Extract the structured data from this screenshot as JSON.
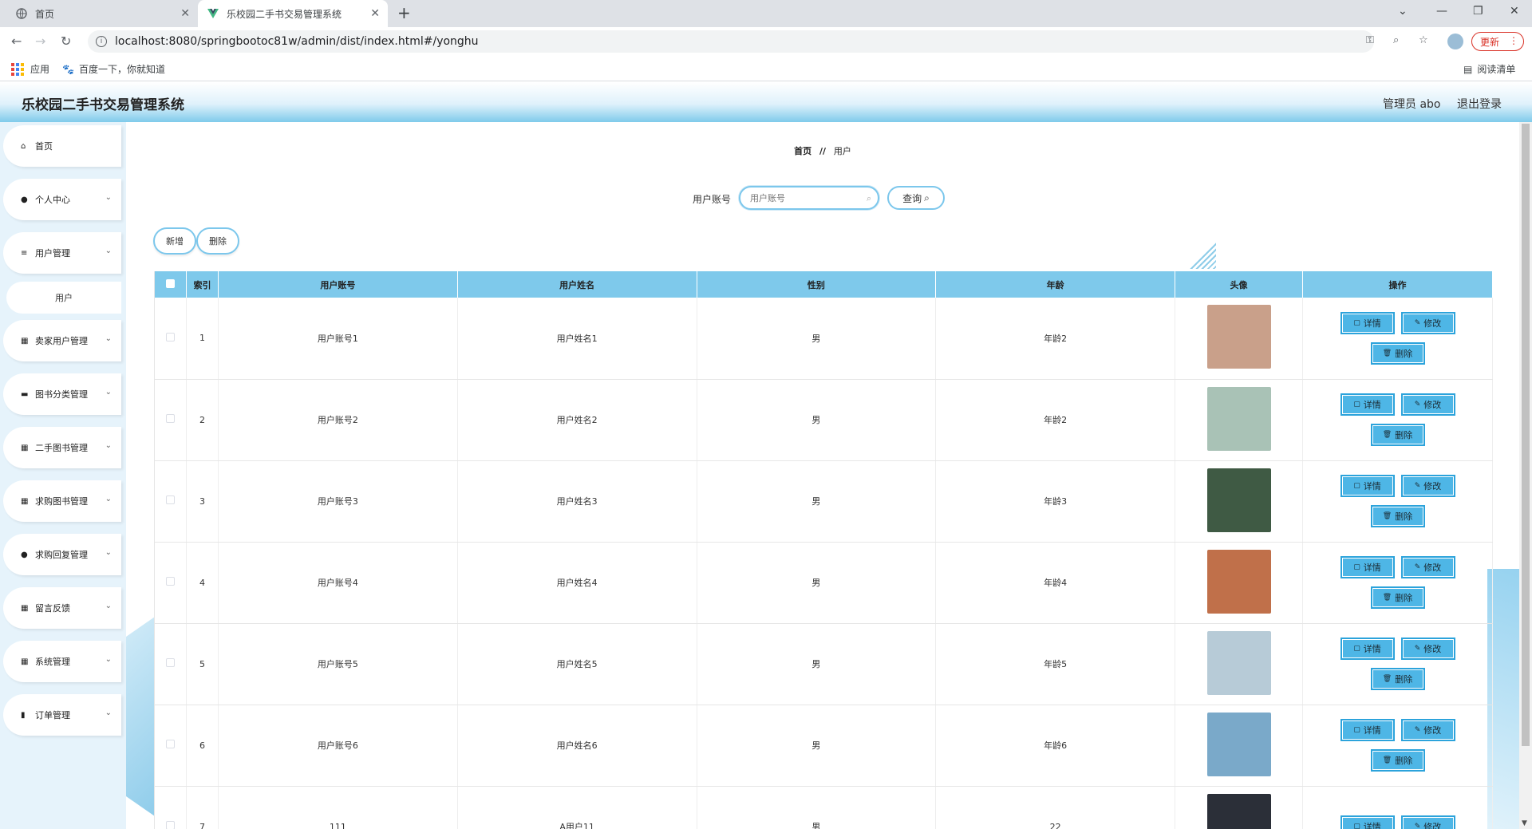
{
  "browser": {
    "tabs": [
      {
        "title": "首页",
        "icon": "globe-icon"
      },
      {
        "title": "乐校园二手书交易管理系统",
        "icon": "vue-icon"
      }
    ],
    "url": "localhost:8080/springbootoc81w/admin/dist/index.html#/yonghu",
    "update_label": "更新",
    "bookmarks": [
      {
        "label": "应用"
      },
      {
        "label": "百度一下，你就知道"
      }
    ],
    "reading_list": "阅读清单"
  },
  "header": {
    "title": "乐校园二手书交易管理系统",
    "user": "管理员 abo",
    "logout": "退出登录"
  },
  "sidebar": {
    "items": [
      {
        "label": "首页",
        "icon": "home-icon"
      },
      {
        "label": "个人中心",
        "icon": "user-icon"
      },
      {
        "label": "用户管理",
        "icon": "sliders-icon"
      },
      {
        "label": "卖家用户管理",
        "icon": "grid-icon"
      },
      {
        "label": "图书分类管理",
        "icon": "briefcase-icon"
      },
      {
        "label": "二手图书管理",
        "icon": "grid-icon"
      },
      {
        "label": "求购图书管理",
        "icon": "grid-icon"
      },
      {
        "label": "求购回复管理",
        "icon": "user-icon"
      },
      {
        "label": "留言反馈",
        "icon": "grid-icon"
      },
      {
        "label": "系统管理",
        "icon": "grid-icon"
      },
      {
        "label": "订单管理",
        "icon": "bar-chart-icon"
      }
    ],
    "sub_active": "用户"
  },
  "main": {
    "breadcrumb": {
      "home": "首页",
      "separator": "//",
      "current": "用户"
    },
    "search": {
      "label": "用户账号",
      "placeholder": "用户账号",
      "button": "查询"
    },
    "add_button": "新增",
    "delete_button": "删除",
    "columns": [
      "索引",
      "用户账号",
      "用户姓名",
      "性别",
      "年龄",
      "头像",
      "操作"
    ],
    "op_labels": {
      "detail": "详情",
      "edit": "修改",
      "delete": "删除"
    },
    "rows": [
      {
        "index": "1",
        "account": "用户账号1",
        "name": "用户姓名1",
        "gender": "男",
        "age": "年龄2",
        "avatar_color": "#c9a08a"
      },
      {
        "index": "2",
        "account": "用户账号2",
        "name": "用户姓名2",
        "gender": "男",
        "age": "年龄2",
        "avatar_color": "#a9c2b6"
      },
      {
        "index": "3",
        "account": "用户账号3",
        "name": "用户姓名3",
        "gender": "男",
        "age": "年龄3",
        "avatar_color": "#3f5a44"
      },
      {
        "index": "4",
        "account": "用户账号4",
        "name": "用户姓名4",
        "gender": "男",
        "age": "年龄4",
        "avatar_color": "#c0704a"
      },
      {
        "index": "5",
        "account": "用户账号5",
        "name": "用户姓名5",
        "gender": "男",
        "age": "年龄5",
        "avatar_color": "#b7cbd7"
      },
      {
        "index": "6",
        "account": "用户账号6",
        "name": "用户姓名6",
        "gender": "男",
        "age": "年龄6",
        "avatar_color": "#7aa9c9"
      },
      {
        "index": "7",
        "account": "111",
        "name": "A用户11",
        "gender": "男",
        "age": "22",
        "avatar_color": "#2b2f38"
      }
    ]
  },
  "colors": {
    "accent": "#7ec9eb",
    "button_fill": "#4eb6e6",
    "sidebar_bg": "#e6f3fb"
  }
}
